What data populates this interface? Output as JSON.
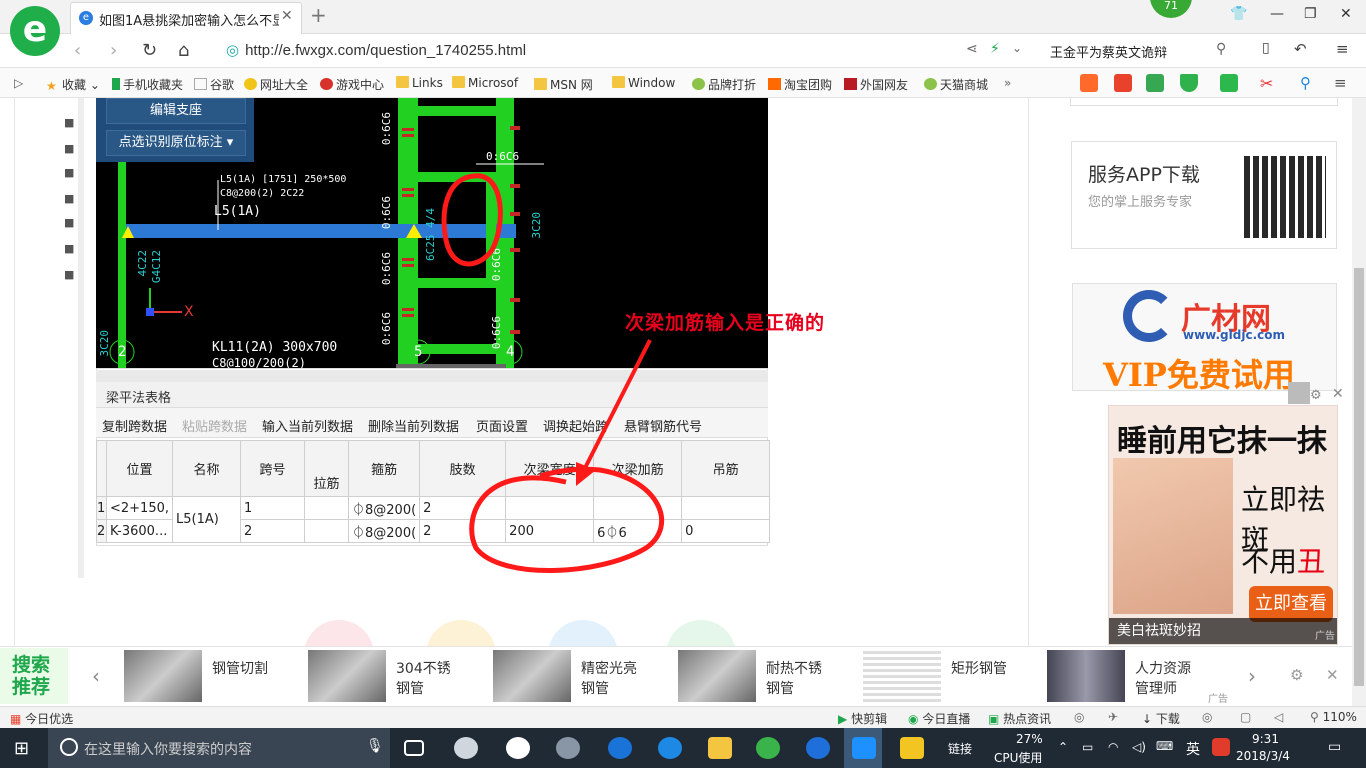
{
  "browser": {
    "tab_title": "如图1A悬挑梁加密输入怎么不显",
    "tab_close": "✕",
    "new_tab": "+",
    "badge_count": "71",
    "url": "http://e.fwxgx.com/question_1740255.html",
    "search_text": "王金平为蔡英文诡辩",
    "bookmarks": [
      "收藏",
      "手机收藏夹",
      "谷歌",
      "网址大全",
      "游戏中心",
      "Links",
      "Microsof",
      "MSN 网",
      "Window",
      "品牌打折",
      "淘宝团购",
      "外国网友",
      "天猫商城"
    ],
    "more_bookmarks": "»"
  },
  "cad": {
    "edit_support": "编辑支座",
    "pick_label": "点选识别原位标注",
    "beam_label1": "L5(1A) [1751] 250*500",
    "beam_label2": "C8@200(2) 2C22",
    "beam_name": "L5(1A)",
    "kl_label1": "KL11(2A) 300x700",
    "kl_label2": "C8@100/200(2)",
    "axis_x": "X",
    "axis_2": "2",
    "axis_5": "5",
    "axis_4": "4",
    "v_06c6": "0:6C6",
    "v_6c25": "6C25 4/4",
    "v_3c20": "3C20",
    "v_4c22": "4C22",
    "v_g4c12": "G4C12",
    "v_3c20b": "3C20",
    "h_06c6": "0:6C6"
  },
  "table": {
    "panel_title": "梁平法表格",
    "tools": [
      "复制跨数据",
      "粘贴跨数据",
      "输入当前列数据",
      "删除当前列数据",
      "页面设置",
      "调换起始跨",
      "悬臂钢筋代号"
    ],
    "headers": [
      "位置",
      "名称",
      "跨号",
      "拉筋",
      "箍筋",
      "肢数",
      "次梁宽度",
      "次梁加筋",
      "吊筋"
    ],
    "rows": [
      {
        "idx": "1",
        "pos": "<2+150,",
        "name": "L5(1A)",
        "span": "1",
        "tie": "",
        "stirrup": "⏀8@200(",
        "legs": "2",
        "sec_w": "",
        "sec_add": "",
        "hang": ""
      },
      {
        "idx": "2",
        "pos": "K-3600...",
        "name": "",
        "span": "2",
        "tie": "",
        "stirrup": "⏀8@200(",
        "legs": "2",
        "sec_w": "200",
        "sec_add": "6⏀6",
        "hang": "0"
      }
    ]
  },
  "annotation": "次梁加筋输入是正确的",
  "sidebar": {
    "service_title": "服务APP下载",
    "service_sub": "您的掌上服务专家",
    "gl_name": "广材网",
    "gl_url": "www.gldjc.com",
    "gl_vip": "VIP免费试用",
    "ad_head": "睡前用它抹一抹",
    "ad_line1": "立即祛斑",
    "ad_line2_a": "不用",
    "ad_line2_b": "丑",
    "ad_btn": "立即查看",
    "ad_caption": "美白祛斑妙招",
    "ad_tag": "广告"
  },
  "recommend": {
    "tag": "搜索推荐",
    "items": [
      {
        "t1": "钢管切割",
        "t2": ""
      },
      {
        "t1": "304不锈",
        "t2": "钢管"
      },
      {
        "t1": "精密光亮",
        "t2": "钢管"
      },
      {
        "t1": "耐热不锈",
        "t2": "钢管"
      },
      {
        "t1": "矩形钢管",
        "t2": ""
      },
      {
        "t1": "人力资源",
        "t2": "管理师"
      }
    ],
    "ad": "广告"
  },
  "status": {
    "today": "今日优选",
    "quick": "快剪辑",
    "live": "今日直播",
    "news": "热点资讯",
    "download": "下载",
    "zoom": "110%"
  },
  "taskbar": {
    "search_placeholder": "在这里输入你要搜索的内容",
    "link": "链接",
    "cpu_pct": "27%",
    "cpu_lbl": "CPU使用",
    "ime": "英",
    "time": "9:31",
    "date": "2018/3/4"
  }
}
